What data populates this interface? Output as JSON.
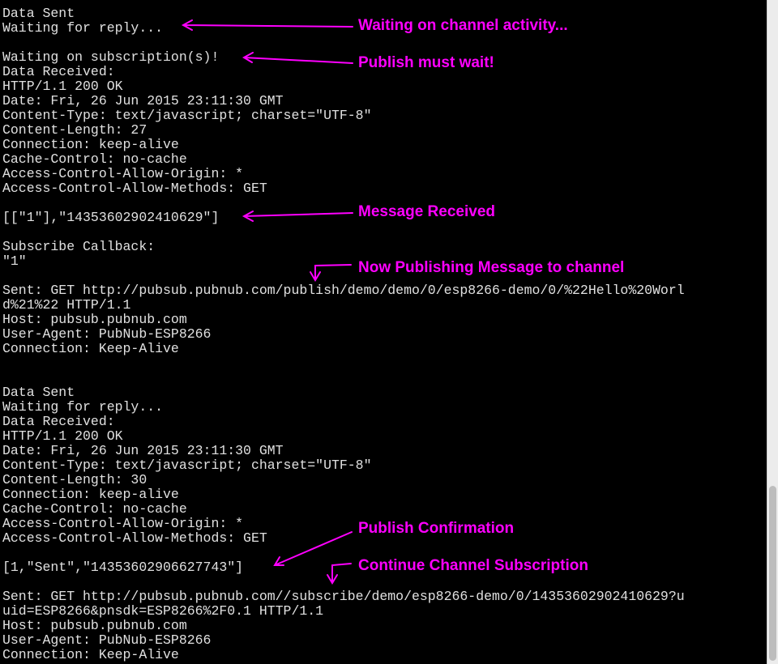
{
  "terminal_lines": [
    "Data Sent",
    "Waiting for reply...",
    "",
    "Waiting on subscription(s)!",
    "Data Received:",
    "HTTP/1.1 200 OK",
    "Date: Fri, 26 Jun 2015 23:11:30 GMT",
    "Content-Type: text/javascript; charset=\"UTF-8\"",
    "Content-Length: 27",
    "Connection: keep-alive",
    "Cache-Control: no-cache",
    "Access-Control-Allow-Origin: *",
    "Access-Control-Allow-Methods: GET",
    "",
    "[[\"1\"],\"14353602902410629\"]",
    "",
    "Subscribe Callback:",
    "\"1\"",
    "",
    "Sent: GET http://pubsub.pubnub.com/publish/demo/demo/0/esp8266-demo/0/%22Hello%20Worl",
    "d%21%22 HTTP/1.1",
    "Host: pubsub.pubnub.com",
    "User-Agent: PubNub-ESP8266",
    "Connection: Keep-Alive",
    "",
    "",
    "Data Sent",
    "Waiting for reply...",
    "Data Received:",
    "HTTP/1.1 200 OK",
    "Date: Fri, 26 Jun 2015 23:11:30 GMT",
    "Content-Type: text/javascript; charset=\"UTF-8\"",
    "Content-Length: 30",
    "Connection: keep-alive",
    "Cache-Control: no-cache",
    "Access-Control-Allow-Origin: *",
    "Access-Control-Allow-Methods: GET",
    "",
    "[1,\"Sent\",\"14353602906627743\"]",
    "",
    "Sent: GET http://pubsub.pubnub.com//subscribe/demo/esp8266-demo/0/14353602902410629?u",
    "uid=ESP8266&pnsdk=ESP8266%2F0.1 HTTP/1.1",
    "Host: pubsub.pubnub.com",
    "User-Agent: PubNub-ESP8266",
    "Connection: Keep-Alive"
  ],
  "annotations": [
    "Waiting on channel activity...",
    "Publish must wait!",
    "Message Received",
    "Now Publishing Message to channel",
    "Publish Confirmation",
    "Continue Channel Subscription"
  ],
  "colors": {
    "background": "#000000",
    "terminal_text": "#e0e0e0",
    "annotation": "#ff00ff"
  }
}
